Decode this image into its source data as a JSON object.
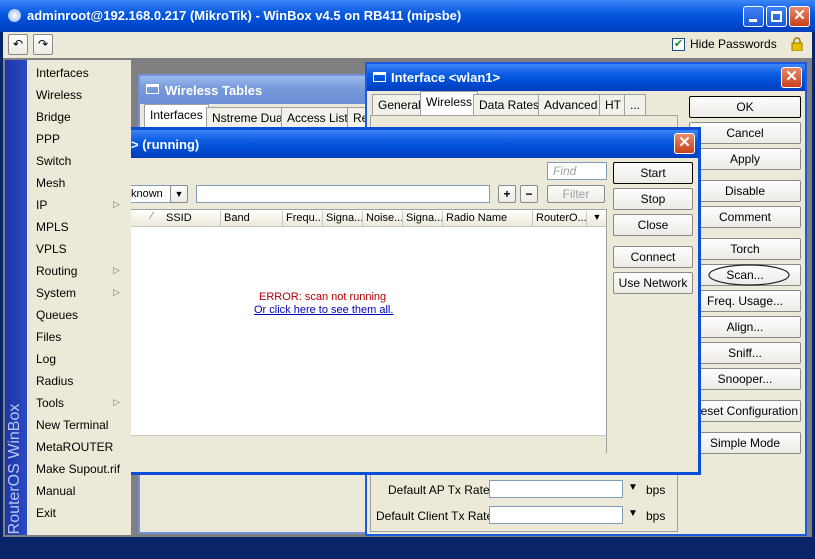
{
  "window": {
    "title": "adminroot@192.168.0.217 (MikroTik) - WinBox v4.5 on RB411 (mipsbe)",
    "hide_passwords_label": "Hide Passwords",
    "brand_vertical": "RouterOS WinBox"
  },
  "menu": {
    "items": [
      {
        "label": "Interfaces"
      },
      {
        "label": "Wireless"
      },
      {
        "label": "Bridge"
      },
      {
        "label": "PPP"
      },
      {
        "label": "Switch"
      },
      {
        "label": "Mesh"
      },
      {
        "label": "IP"
      },
      {
        "label": "MPLS"
      },
      {
        "label": "VPLS"
      },
      {
        "label": "Routing"
      },
      {
        "label": "System"
      },
      {
        "label": "Queues"
      },
      {
        "label": "Files"
      },
      {
        "label": "Log"
      },
      {
        "label": "Radius"
      },
      {
        "label": "Tools"
      },
      {
        "label": "New Terminal"
      },
      {
        "label": "MetaROUTER"
      },
      {
        "label": "Make Supout.rif"
      },
      {
        "label": "Manual"
      },
      {
        "label": "Exit"
      }
    ]
  },
  "wireless_tables": {
    "title": "Wireless Tables",
    "tabs": [
      "Interfaces",
      "Nstreme Dual",
      "Access List",
      "Re"
    ]
  },
  "interface_dialog": {
    "title": "Interface <wlan1>",
    "tabs": [
      "General",
      "Wireless",
      "Data Rates",
      "Advanced",
      "HT",
      "..."
    ],
    "buttons": [
      "OK",
      "Cancel",
      "Apply",
      "Disable",
      "Comment",
      "Torch",
      "Scan...",
      "Freq. Usage...",
      "Align...",
      "Sniff...",
      "Snooper...",
      "Reset Configuration",
      "Simple Mode"
    ],
    "default_ap_tx_rate_label": "Default AP Tx Rate:",
    "default_client_tx_rate_label": "Default Client Tx Rate:",
    "unit": "bps"
  },
  "scan_dialog": {
    "title": "> (running)",
    "find_placeholder": "Find",
    "filter_select_value": "known",
    "filter_button": "Filter",
    "columns": [
      "SSID",
      "Band",
      "Frequ...",
      "Signa...",
      "Noise...",
      "Signa...",
      "Radio Name",
      "RouterO..."
    ],
    "error_text": "ERROR: scan not running",
    "link_text": "Or click here to see them all.",
    "buttons": [
      "Start",
      "Stop",
      "Close",
      "Connect",
      "Use Network"
    ]
  }
}
